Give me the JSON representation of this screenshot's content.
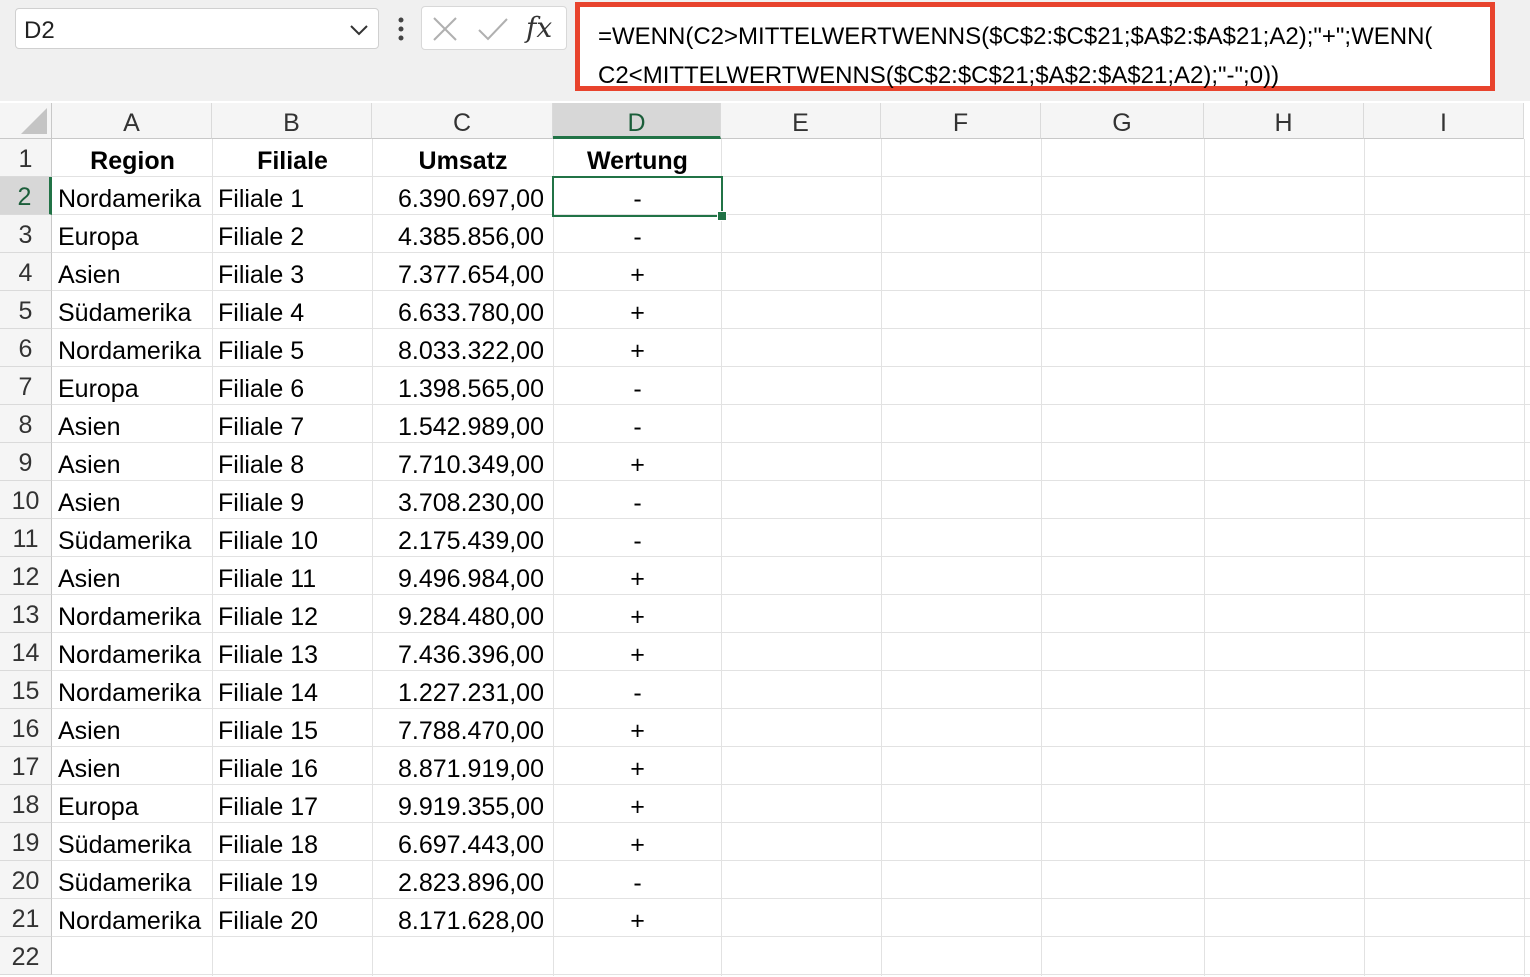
{
  "name_box": {
    "value": "D2"
  },
  "formula_bar": {
    "formula": "=WENN(C2>MITTELWERTWENNS($C$2:$C$21;$A$2:$A$21;A2);\"+\";WENN(\nC2<MITTELWERTWENNS($C$2:$C$21;$A$2:$A$21;A2);\"-\";0))",
    "fx_label": "fx",
    "highlight_color": "#e8432d"
  },
  "grid": {
    "columns": [
      "A",
      "B",
      "C",
      "D",
      "E",
      "F",
      "G",
      "H",
      "I"
    ],
    "rows": [
      "1",
      "2",
      "3",
      "4",
      "5",
      "6",
      "7",
      "8",
      "9",
      "10",
      "11",
      "12",
      "13",
      "14",
      "15",
      "16",
      "17",
      "18",
      "19",
      "20",
      "21",
      "22"
    ],
    "active_cell": "D2",
    "selection_color": "#217346",
    "headers": {
      "region": "Region",
      "filiale": "Filiale",
      "umsatz": "Umsatz",
      "wertung": "Wertung"
    },
    "data": [
      {
        "region": "Nordamerika",
        "filiale": "Filiale 1",
        "umsatz": "6.390.697,00",
        "wertung": "-"
      },
      {
        "region": "Europa",
        "filiale": "Filiale 2",
        "umsatz": "4.385.856,00",
        "wertung": "-"
      },
      {
        "region": "Asien",
        "filiale": "Filiale 3",
        "umsatz": "7.377.654,00",
        "wertung": "+"
      },
      {
        "region": "Südamerika",
        "filiale": "Filiale 4",
        "umsatz": "6.633.780,00",
        "wertung": "+"
      },
      {
        "region": "Nordamerika",
        "filiale": "Filiale 5",
        "umsatz": "8.033.322,00",
        "wertung": "+"
      },
      {
        "region": "Europa",
        "filiale": "Filiale 6",
        "umsatz": "1.398.565,00",
        "wertung": "-"
      },
      {
        "region": "Asien",
        "filiale": "Filiale 7",
        "umsatz": "1.542.989,00",
        "wertung": "-"
      },
      {
        "region": "Asien",
        "filiale": "Filiale 8",
        "umsatz": "7.710.349,00",
        "wertung": "+"
      },
      {
        "region": "Asien",
        "filiale": "Filiale 9",
        "umsatz": "3.708.230,00",
        "wertung": "-"
      },
      {
        "region": "Südamerika",
        "filiale": "Filiale 10",
        "umsatz": "2.175.439,00",
        "wertung": "-"
      },
      {
        "region": "Asien",
        "filiale": "Filiale 11",
        "umsatz": "9.496.984,00",
        "wertung": "+"
      },
      {
        "region": "Nordamerika",
        "filiale": "Filiale 12",
        "umsatz": "9.284.480,00",
        "wertung": "+"
      },
      {
        "region": "Nordamerika",
        "filiale": "Filiale 13",
        "umsatz": "7.436.396,00",
        "wertung": "+"
      },
      {
        "region": "Nordamerika",
        "filiale": "Filiale 14",
        "umsatz": "1.227.231,00",
        "wertung": "-"
      },
      {
        "region": "Asien",
        "filiale": "Filiale 15",
        "umsatz": "7.788.470,00",
        "wertung": "+"
      },
      {
        "region": "Asien",
        "filiale": "Filiale 16",
        "umsatz": "8.871.919,00",
        "wertung": "+"
      },
      {
        "region": "Europa",
        "filiale": "Filiale 17",
        "umsatz": "9.919.355,00",
        "wertung": "+"
      },
      {
        "region": "Südamerika",
        "filiale": "Filiale 18",
        "umsatz": "6.697.443,00",
        "wertung": "+"
      },
      {
        "region": "Südamerika",
        "filiale": "Filiale 19",
        "umsatz": "2.823.896,00",
        "wertung": "-"
      },
      {
        "region": "Nordamerika",
        "filiale": "Filiale 20",
        "umsatz": "8.171.628,00",
        "wertung": "+"
      }
    ]
  }
}
